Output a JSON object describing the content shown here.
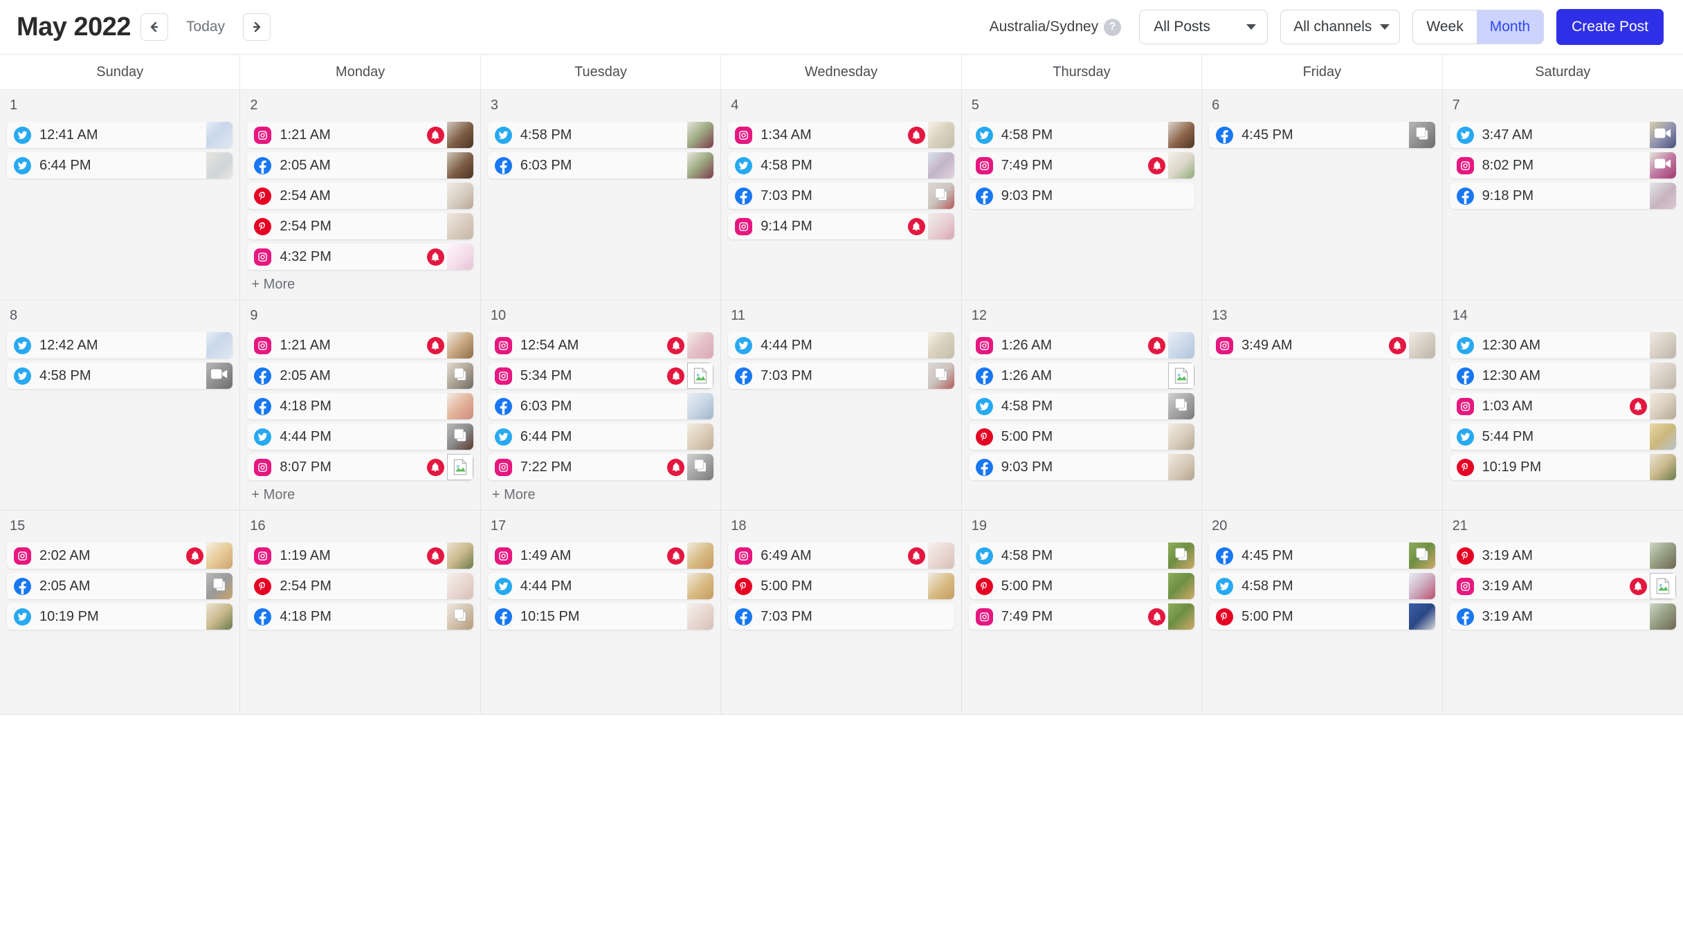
{
  "header": {
    "month_title": "May 2022",
    "prev_label": "prev",
    "today_label": "Today",
    "next_label": "next",
    "timezone": "Australia/Sydney",
    "help_label": "?",
    "post_filter": "All Posts",
    "channel_filter": "All channels",
    "view_week": "Week",
    "view_month": "Month",
    "active_view": "Month",
    "create_post": "Create Post",
    "accent_color": "#2f2fe8",
    "active_toggle_bg": "#ccd4fd",
    "active_toggle_fg": "#2f44f5"
  },
  "weekdays": [
    "Sunday",
    "Monday",
    "Tuesday",
    "Wednesday",
    "Thursday",
    "Friday",
    "Saturday"
  ],
  "platform_colors": {
    "instagram": "#e6187f",
    "facebook": "#1877f2",
    "twitter": "#27a9f1",
    "pinterest": "#e60023",
    "alert": "#e3173f"
  },
  "more_label": "+ More",
  "weeks": [
    {
      "days": [
        {
          "num": "1",
          "more": false,
          "posts": [
            {
              "platform": "twitter",
              "time": "12:41 AM",
              "alert": false,
              "thumb": "collage",
              "media": "none"
            },
            {
              "platform": "twitter",
              "time": "6:44 PM",
              "alert": false,
              "thumb": "gift",
              "media": "none"
            }
          ]
        },
        {
          "num": "2",
          "more": true,
          "posts": [
            {
              "platform": "instagram",
              "time": "1:21 AM",
              "alert": true,
              "thumb": "blanket",
              "media": "none"
            },
            {
              "platform": "facebook",
              "time": "2:05 AM",
              "alert": false,
              "thumb": "blanket",
              "media": "none"
            },
            {
              "platform": "pinterest",
              "time": "2:54 AM",
              "alert": false,
              "thumb": "desk",
              "media": "none"
            },
            {
              "platform": "pinterest",
              "time": "2:54 PM",
              "alert": false,
              "thumb": "flatlay",
              "media": "none"
            },
            {
              "platform": "instagram",
              "time": "4:32 PM",
              "alert": true,
              "thumb": "card",
              "media": "none"
            }
          ]
        },
        {
          "num": "3",
          "more": false,
          "posts": [
            {
              "platform": "twitter",
              "time": "4:58 PM",
              "alert": false,
              "thumb": "wine",
              "media": "none"
            },
            {
              "platform": "facebook",
              "time": "6:03 PM",
              "alert": false,
              "thumb": "wine",
              "media": "none"
            }
          ]
        },
        {
          "num": "4",
          "more": false,
          "posts": [
            {
              "platform": "instagram",
              "time": "1:34 AM",
              "alert": true,
              "thumb": "desk2",
              "media": "none"
            },
            {
              "platform": "twitter",
              "time": "4:58 PM",
              "alert": false,
              "thumb": "moodboard",
              "media": "none"
            },
            {
              "platform": "facebook",
              "time": "7:03 PM",
              "alert": false,
              "thumb": "petals",
              "media": "carousel"
            },
            {
              "platform": "instagram",
              "time": "9:14 PM",
              "alert": true,
              "thumb": "bottle",
              "media": "none"
            }
          ]
        },
        {
          "num": "5",
          "more": false,
          "posts": [
            {
              "platform": "twitter",
              "time": "4:58 PM",
              "alert": false,
              "thumb": "choc",
              "media": "none"
            },
            {
              "platform": "instagram",
              "time": "7:49 PM",
              "alert": true,
              "thumb": "notebook",
              "media": "none"
            },
            {
              "platform": "facebook",
              "time": "9:03 PM",
              "alert": false,
              "thumb": "none",
              "media": "none"
            }
          ]
        },
        {
          "num": "6",
          "more": false,
          "posts": [
            {
              "platform": "facebook",
              "time": "4:45 PM",
              "alert": false,
              "thumb": "grey",
              "media": "carousel"
            }
          ]
        },
        {
          "num": "7",
          "more": false,
          "posts": [
            {
              "platform": "twitter",
              "time": "3:47 AM",
              "alert": false,
              "thumb": "lavender",
              "media": "video"
            },
            {
              "platform": "instagram",
              "time": "8:02 PM",
              "alert": false,
              "thumb": "flowers",
              "media": "video"
            },
            {
              "platform": "facebook",
              "time": "9:18 PM",
              "alert": false,
              "thumb": "street",
              "media": "none"
            }
          ]
        }
      ]
    },
    {
      "days": [
        {
          "num": "8",
          "more": false,
          "posts": [
            {
              "platform": "twitter",
              "time": "12:42 AM",
              "alert": false,
              "thumb": "collage",
              "media": "none"
            },
            {
              "platform": "twitter",
              "time": "4:58 PM",
              "alert": false,
              "thumb": "grey",
              "media": "video"
            }
          ]
        },
        {
          "num": "9",
          "more": true,
          "posts": [
            {
              "platform": "instagram",
              "time": "1:21 AM",
              "alert": true,
              "thumb": "hands",
              "media": "none"
            },
            {
              "platform": "facebook",
              "time": "2:05 AM",
              "alert": false,
              "thumb": "book",
              "media": "carousel"
            },
            {
              "platform": "facebook",
              "time": "4:18 PM",
              "alert": false,
              "thumb": "vases",
              "media": "none"
            },
            {
              "platform": "twitter",
              "time": "4:44 PM",
              "alert": false,
              "thumb": "bottle2",
              "media": "carousel"
            },
            {
              "platform": "instagram",
              "time": "8:07 PM",
              "alert": true,
              "thumb": "broken",
              "media": "broken"
            }
          ]
        },
        {
          "num": "10",
          "more": true,
          "posts": [
            {
              "platform": "instagram",
              "time": "12:54 AM",
              "alert": true,
              "thumb": "vase",
              "media": "none"
            },
            {
              "platform": "instagram",
              "time": "5:34 PM",
              "alert": true,
              "thumb": "broken",
              "media": "broken"
            },
            {
              "platform": "facebook",
              "time": "6:03 PM",
              "alert": false,
              "thumb": "palette",
              "media": "none"
            },
            {
              "platform": "twitter",
              "time": "6:44 PM",
              "alert": false,
              "thumb": "flatlay2",
              "media": "none"
            },
            {
              "platform": "instagram",
              "time": "7:22 PM",
              "alert": true,
              "thumb": "laptop",
              "media": "carousel"
            }
          ]
        },
        {
          "num": "11",
          "more": false,
          "posts": [
            {
              "platform": "twitter",
              "time": "4:44 PM",
              "alert": false,
              "thumb": "desk2",
              "media": "none"
            },
            {
              "platform": "facebook",
              "time": "7:03 PM",
              "alert": false,
              "thumb": "petals",
              "media": "carousel"
            }
          ]
        },
        {
          "num": "12",
          "more": false,
          "posts": [
            {
              "platform": "instagram",
              "time": "1:26 AM",
              "alert": true,
              "thumb": "collage2",
              "media": "none"
            },
            {
              "platform": "facebook",
              "time": "1:26 AM",
              "alert": false,
              "thumb": "broken",
              "media": "broken"
            },
            {
              "platform": "twitter",
              "time": "4:58 PM",
              "alert": false,
              "thumb": "laptop",
              "media": "carousel"
            },
            {
              "platform": "pinterest",
              "time": "5:00 PM",
              "alert": false,
              "thumb": "tray",
              "media": "none"
            },
            {
              "platform": "facebook",
              "time": "9:03 PM",
              "alert": false,
              "thumb": "tray2",
              "media": "none"
            }
          ]
        },
        {
          "num": "13",
          "more": false,
          "posts": [
            {
              "platform": "instagram",
              "time": "3:49 AM",
              "alert": true,
              "thumb": "candles",
              "media": "none"
            }
          ]
        },
        {
          "num": "14",
          "more": false,
          "posts": [
            {
              "platform": "twitter",
              "time": "12:30 AM",
              "alert": false,
              "thumb": "candles",
              "media": "none"
            },
            {
              "platform": "facebook",
              "time": "12:30 AM",
              "alert": false,
              "thumb": "candles",
              "media": "none"
            },
            {
              "platform": "instagram",
              "time": "1:03 AM",
              "alert": true,
              "thumb": "tray",
              "media": "none"
            },
            {
              "platform": "twitter",
              "time": "5:44 PM",
              "alert": false,
              "thumb": "book2",
              "media": "none"
            },
            {
              "platform": "pinterest",
              "time": "10:19 PM",
              "alert": false,
              "thumb": "dessert",
              "media": "none"
            }
          ]
        }
      ]
    },
    {
      "days": [
        {
          "num": "15",
          "more": false,
          "posts": [
            {
              "platform": "instagram",
              "time": "2:02 AM",
              "alert": true,
              "thumb": "macarons",
              "media": "none"
            },
            {
              "platform": "facebook",
              "time": "2:05 AM",
              "alert": false,
              "thumb": "cone",
              "media": "carousel"
            },
            {
              "platform": "twitter",
              "time": "10:19 PM",
              "alert": false,
              "thumb": "dessert",
              "media": "none"
            }
          ]
        },
        {
          "num": "16",
          "more": false,
          "posts": [
            {
              "platform": "instagram",
              "time": "1:19 AM",
              "alert": true,
              "thumb": "dessert",
              "media": "none"
            },
            {
              "platform": "pinterest",
              "time": "2:54 PM",
              "alert": false,
              "thumb": "stationery",
              "media": "none"
            },
            {
              "platform": "facebook",
              "time": "4:18 PM",
              "alert": false,
              "thumb": "box",
              "media": "carousel"
            }
          ]
        },
        {
          "num": "17",
          "more": false,
          "posts": [
            {
              "platform": "instagram",
              "time": "1:49 AM",
              "alert": true,
              "thumb": "cone2",
              "media": "none"
            },
            {
              "platform": "twitter",
              "time": "4:44 PM",
              "alert": false,
              "thumb": "cone2",
              "media": "none"
            },
            {
              "platform": "facebook",
              "time": "10:15 PM",
              "alert": false,
              "thumb": "stationery",
              "media": "none"
            }
          ]
        },
        {
          "num": "18",
          "more": false,
          "posts": [
            {
              "platform": "instagram",
              "time": "6:49 AM",
              "alert": true,
              "thumb": "stationery",
              "media": "none"
            },
            {
              "platform": "pinterest",
              "time": "5:00 PM",
              "alert": false,
              "thumb": "cone2",
              "media": "none"
            },
            {
              "platform": "facebook",
              "time": "7:03 PM",
              "alert": false,
              "thumb": "none",
              "media": "none"
            }
          ]
        },
        {
          "num": "19",
          "more": false,
          "posts": [
            {
              "platform": "twitter",
              "time": "4:58 PM",
              "alert": false,
              "thumb": "garden",
              "media": "carousel"
            },
            {
              "platform": "pinterest",
              "time": "5:00 PM",
              "alert": false,
              "thumb": "garden",
              "media": "none"
            },
            {
              "platform": "instagram",
              "time": "7:49 PM",
              "alert": true,
              "thumb": "garden",
              "media": "none"
            }
          ]
        },
        {
          "num": "20",
          "more": false,
          "posts": [
            {
              "platform": "facebook",
              "time": "4:45 PM",
              "alert": false,
              "thumb": "garden",
              "media": "carousel"
            },
            {
              "platform": "twitter",
              "time": "4:58 PM",
              "alert": false,
              "thumb": "party",
              "media": "none"
            },
            {
              "platform": "pinterest",
              "time": "5:00 PM",
              "alert": false,
              "thumb": "blue",
              "media": "none"
            }
          ]
        },
        {
          "num": "21",
          "more": false,
          "posts": [
            {
              "platform": "pinterest",
              "time": "3:19 AM",
              "alert": false,
              "thumb": "cards",
              "media": "none"
            },
            {
              "platform": "instagram",
              "time": "3:19 AM",
              "alert": true,
              "thumb": "broken",
              "media": "broken"
            },
            {
              "platform": "facebook",
              "time": "3:19 AM",
              "alert": false,
              "thumb": "cards",
              "media": "none"
            }
          ]
        }
      ]
    }
  ]
}
